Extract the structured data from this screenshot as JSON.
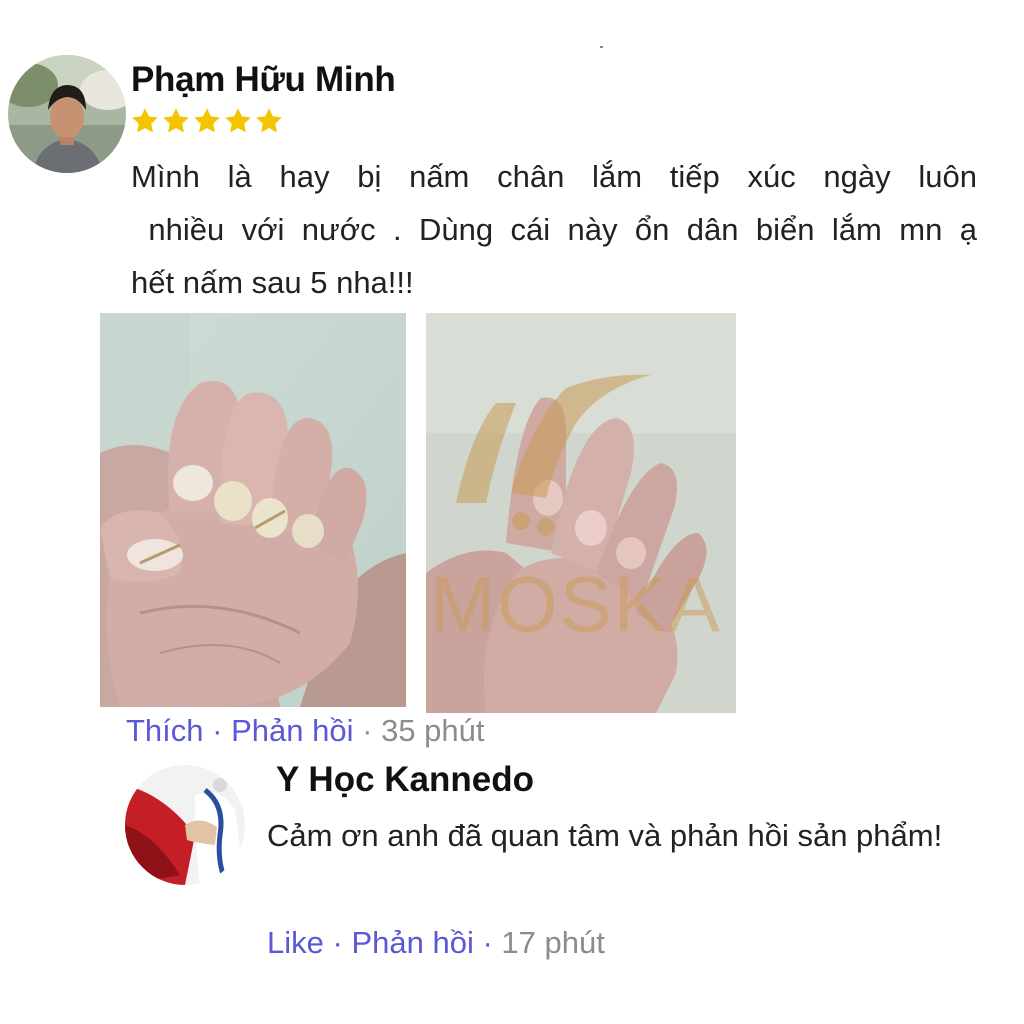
{
  "comment": {
    "author": "Phạm Hữu Minh",
    "rating": 5,
    "body_lines": [
      "Mình là hay bị nấm chân lắm tiếp xúc ngày luôn",
      " nhiều với nước . Dùng cái này ổn dân biển lắm mn ạ",
      "hết nấm sau 5 nha!!!"
    ],
    "photos": [
      {
        "name": "before-hand-photo"
      },
      {
        "name": "after-hand-photo",
        "watermark": "MOSKA"
      }
    ],
    "actions": {
      "like": "Thích",
      "reply": "Phản hồi",
      "separator": "·",
      "time": "35 phút"
    }
  },
  "reply": {
    "author": "Y Học Kannedo",
    "body": "Cảm ơn anh đã quan tâm và phản hồi sản phẩm!",
    "actions": {
      "like": "Like",
      "reply": "Phản hồi",
      "separator": "·",
      "time": "17 phút"
    }
  },
  "colors": {
    "link": "#5a58d6",
    "time": "#8c8c8c",
    "star": "#f5c400"
  }
}
